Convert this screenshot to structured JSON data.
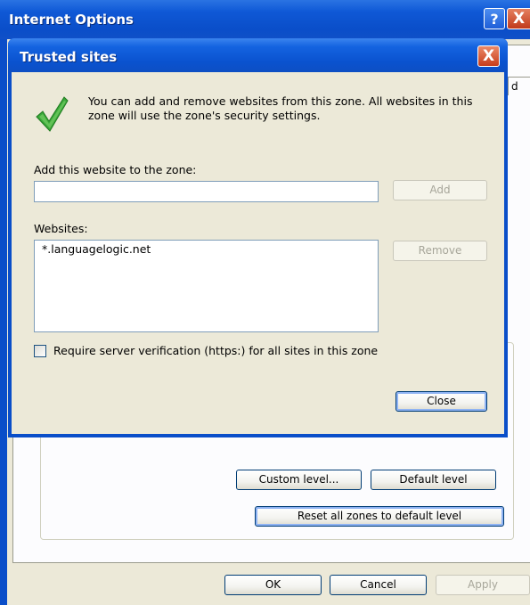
{
  "internet_options": {
    "title": "Internet Options",
    "title_buttons": {
      "help": "?",
      "close": "X"
    },
    "tab_stub_text": "d",
    "buttons": {
      "custom_level": "Custom level...",
      "default_level": "Default level",
      "reset_all_zones": "Reset all zones to default level",
      "ok": "OK",
      "cancel": "Cancel",
      "apply": "Apply"
    }
  },
  "trusted_sites": {
    "title": "Trusted sites",
    "close_glyph": "X",
    "info_text": "You can add and remove websites from this zone. All websites in this zone will use the zone's security settings.",
    "add_label": "Add this website to the zone:",
    "url_input": {
      "value": "",
      "placeholder": ""
    },
    "add_button": "Add",
    "websites_label": "Websites:",
    "websites": [
      "*.languagelogic.net"
    ],
    "remove_button": "Remove",
    "require_verification_label": "Require server verification (https:) for all sites in this zone",
    "require_verification_checked": false,
    "close_button": "Close"
  },
  "icons": {
    "info": "green-checkmark-icon"
  },
  "colors": {
    "titlebar": "#0a4ec9",
    "dialog_face": "#ece9d8",
    "close_red": "#c63c1b"
  }
}
